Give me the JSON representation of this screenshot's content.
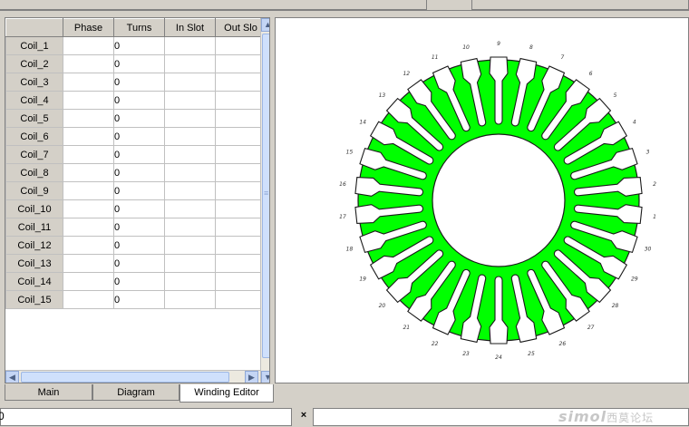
{
  "grid": {
    "columns": [
      "",
      "Phase",
      "Turns",
      "In Slot",
      "Out Slo"
    ],
    "rows": [
      {
        "name": "Coil_1",
        "phase": "",
        "turns": "0",
        "in": "",
        "out": ""
      },
      {
        "name": "Coil_2",
        "phase": "",
        "turns": "0",
        "in": "",
        "out": ""
      },
      {
        "name": "Coil_3",
        "phase": "",
        "turns": "0",
        "in": "",
        "out": ""
      },
      {
        "name": "Coil_4",
        "phase": "",
        "turns": "0",
        "in": "",
        "out": ""
      },
      {
        "name": "Coil_5",
        "phase": "",
        "turns": "0",
        "in": "",
        "out": ""
      },
      {
        "name": "Coil_6",
        "phase": "",
        "turns": "0",
        "in": "",
        "out": ""
      },
      {
        "name": "Coil_7",
        "phase": "",
        "turns": "0",
        "in": "",
        "out": ""
      },
      {
        "name": "Coil_8",
        "phase": "",
        "turns": "0",
        "in": "",
        "out": ""
      },
      {
        "name": "Coil_9",
        "phase": "",
        "turns": "0",
        "in": "",
        "out": ""
      },
      {
        "name": "Coil_10",
        "phase": "",
        "turns": "0",
        "in": "",
        "out": ""
      },
      {
        "name": "Coil_11",
        "phase": "",
        "turns": "0",
        "in": "",
        "out": ""
      },
      {
        "name": "Coil_12",
        "phase": "",
        "turns": "0",
        "in": "",
        "out": ""
      },
      {
        "name": "Coil_13",
        "phase": "",
        "turns": "0",
        "in": "",
        "out": ""
      },
      {
        "name": "Coil_14",
        "phase": "",
        "turns": "0",
        "in": "",
        "out": ""
      },
      {
        "name": "Coil_15",
        "phase": "",
        "turns": "0",
        "in": "",
        "out": ""
      }
    ]
  },
  "tabs": [
    {
      "label": "Main",
      "active": false
    },
    {
      "label": "Diagram",
      "active": false
    },
    {
      "label": "Winding Editor",
      "active": true
    }
  ],
  "stator": {
    "slot_count": 30,
    "fill_color": "#00ff00",
    "outline_color": "#1a1a1a",
    "slot_labels": [
      "1",
      "2",
      "3",
      "4",
      "5",
      "6",
      "7",
      "8",
      "9",
      "10",
      "11",
      "12",
      "13",
      "14",
      "15",
      "16",
      "17",
      "18",
      "19",
      "20",
      "21",
      "22",
      "23",
      "24",
      "25",
      "26",
      "27",
      "28",
      "29",
      "30"
    ]
  },
  "statusbar": {
    "left_text": "0",
    "close_glyph": "×"
  },
  "watermark": {
    "brand": "simol",
    "cn": "西莫论坛"
  },
  "icons": {
    "scroll_up": "▲",
    "scroll_down": "▼",
    "scroll_left": "◀",
    "scroll_right": "▶",
    "grip": "≡"
  }
}
